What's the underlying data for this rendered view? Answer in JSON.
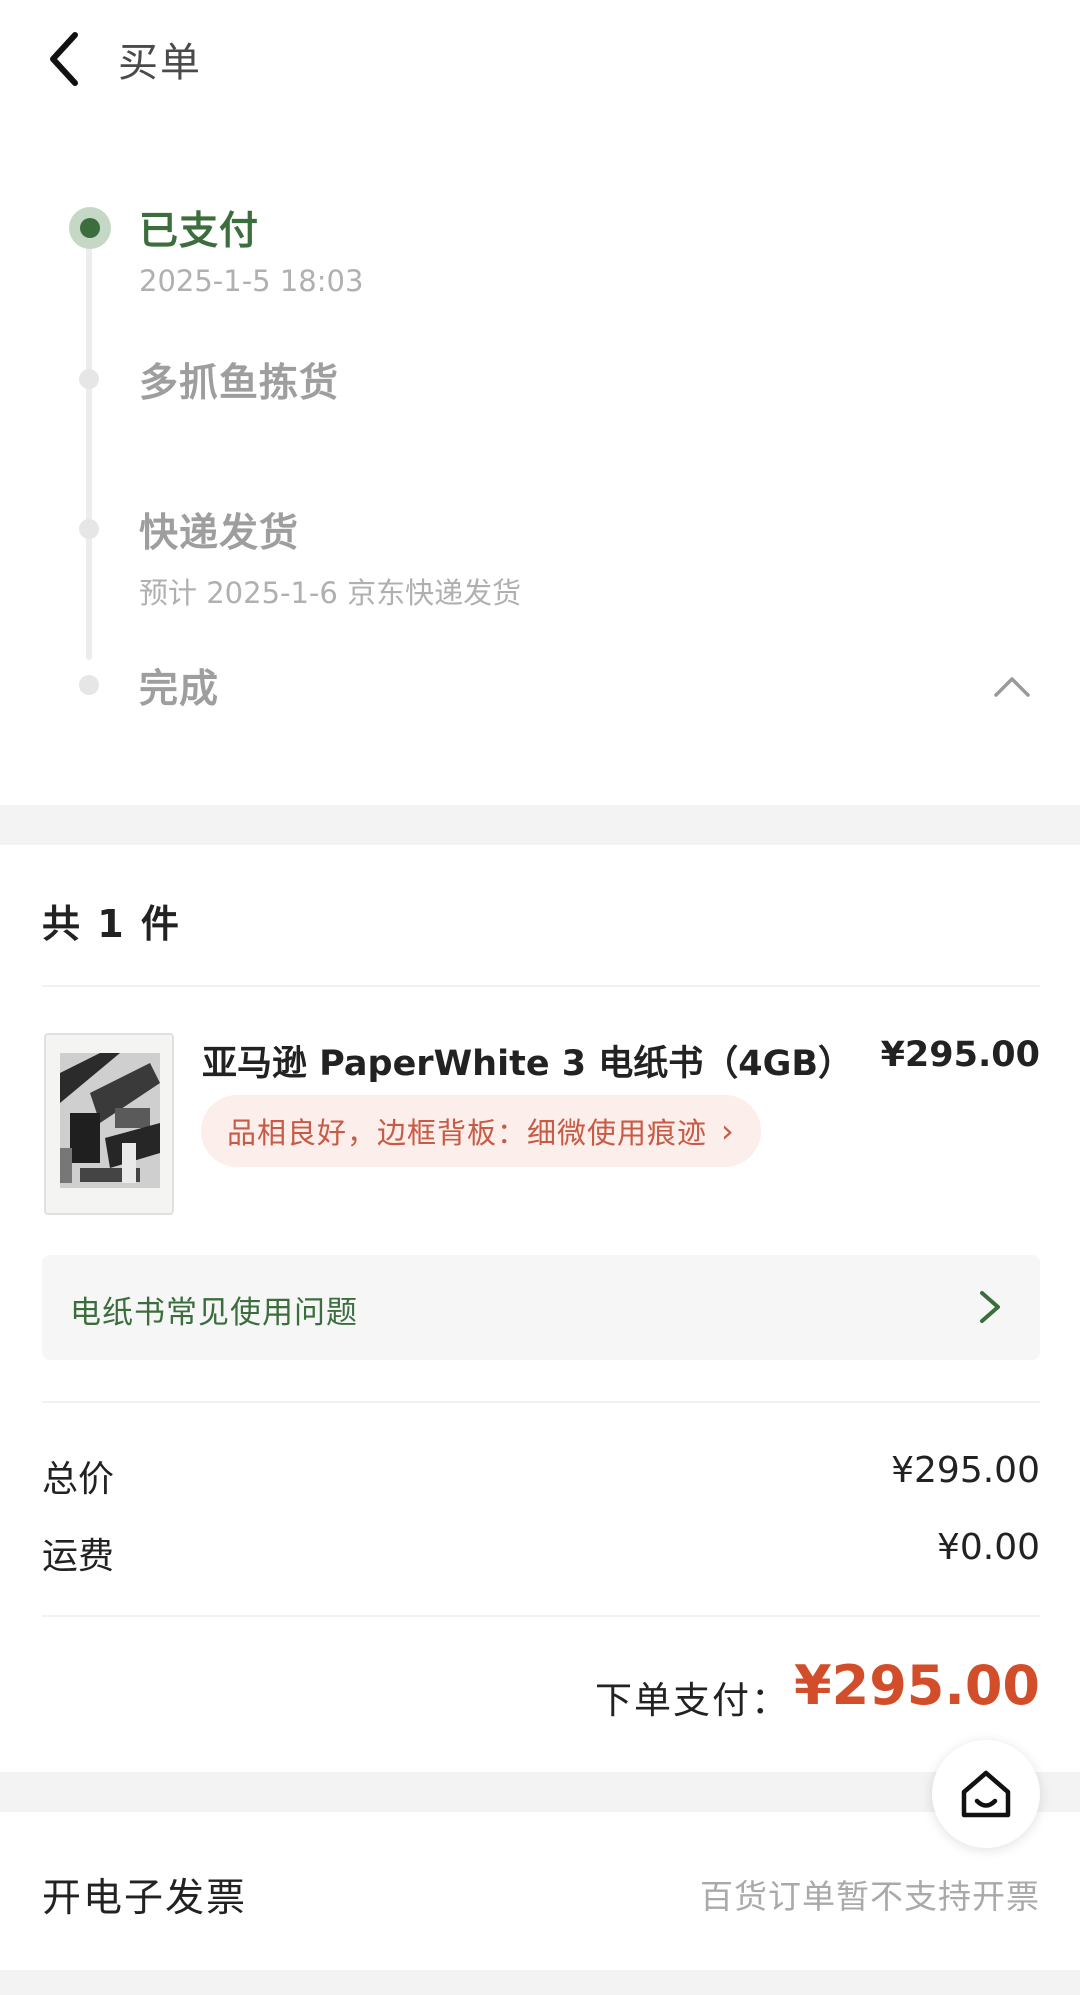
{
  "header": {
    "title": "买单"
  },
  "timeline": {
    "steps": [
      {
        "title": "已支付",
        "subtitle": "2025-1-5 18:03"
      },
      {
        "title": "多抓鱼拣货",
        "subtitle": ""
      },
      {
        "title": "快递发货",
        "subtitle": "预计 2025-1-6 京东快递发货"
      },
      {
        "title": "完成",
        "subtitle": ""
      }
    ]
  },
  "order": {
    "count_label": "共 1 件",
    "items": [
      {
        "name": "亚马逊 PaperWhite 3 电纸书（4GB）",
        "price": "¥295.00",
        "condition": "品相良好，边框背板：细微使用痕迹"
      }
    ],
    "faq_label": "电纸书常见使用问题"
  },
  "summary": {
    "total_label": "总价",
    "total_value": "¥295.00",
    "shipping_label": "运费",
    "shipping_value": "¥0.00",
    "pay_label": "下单支付：",
    "pay_value": "¥295.00"
  },
  "invoice": {
    "label": "开电子发票",
    "note": "百货订单暂不支持开票"
  },
  "colors": {
    "accent_green": "#3c6e3d",
    "price_red": "#d24d2a",
    "tag_bg": "#fceeea",
    "tag_text": "#c75b45"
  },
  "icons": {
    "back": "back-arrow-icon",
    "collapse": "chevron-up-icon",
    "tag_arrow": "chevron-right-icon",
    "faq_arrow": "chevron-right-icon",
    "home": "home-icon"
  }
}
